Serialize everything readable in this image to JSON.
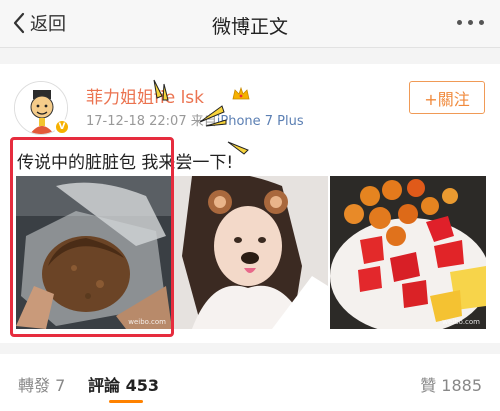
{
  "nav": {
    "back_label": "返回",
    "title": "微博正文"
  },
  "post": {
    "username": "菲力姐姐fie lsk",
    "time": "17-12-18 22:07",
    "source_prefix": "来自",
    "source_device": "iPhone 7 Plus",
    "follow_label": "+關注",
    "text": "传说中的脏脏包 我来尝一下!",
    "images": [
      {
        "alt": "dirty bun pastry in plastic bag"
      },
      {
        "alt": "selfie with bear face filter"
      },
      {
        "alt": "plate of strawberries and fruit"
      }
    ]
  },
  "tabs": {
    "repost": "轉發 7",
    "comments": "評論 453",
    "likes": "贊 1885"
  },
  "colors": {
    "accent": "#ff8200",
    "username": "#eb7350",
    "highlight": "#e62c3e"
  }
}
